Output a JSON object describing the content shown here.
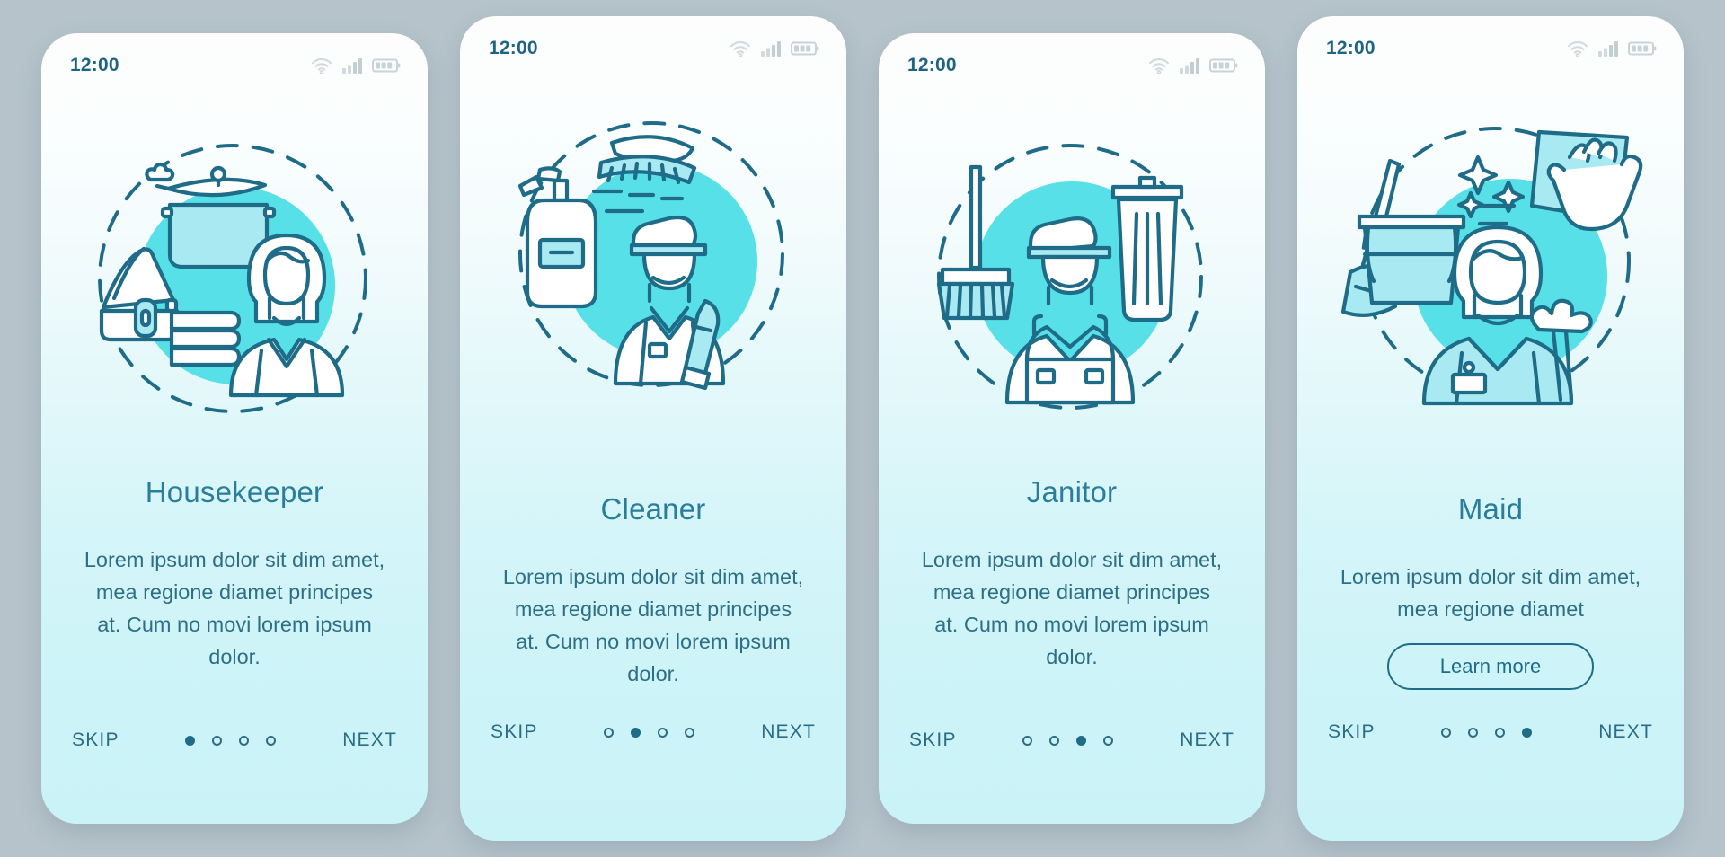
{
  "palette": {
    "page_background": "#b6c3cb",
    "screen_gradient_top": "#fdfdfd",
    "screen_gradient_bottom": "#caf3f8",
    "ink": "#1f6c88",
    "accent_circle": "#58e0e8",
    "fill_light": "#a9e9f2",
    "title_color": "#2a7e9a",
    "body_color": "#2f6f86"
  },
  "status_bar": {
    "time": "12:00",
    "icons": [
      "wifi-icon",
      "cellular-signal-icon",
      "battery-icon"
    ]
  },
  "nav": {
    "skip_label": "SKIP",
    "next_label": "NEXT",
    "total_dots": 4
  },
  "screens": [
    {
      "id": "housekeeper",
      "illustration": "housekeeper-illustration",
      "illustration_items": [
        "steaming-pot-icon",
        "iron-icon",
        "folded-towels-icon",
        "housekeeper-woman-icon"
      ],
      "title": "Housekeeper",
      "body": "Lorem ipsum dolor sit dim amet, mea regione diamet principes at. Cum no movi lorem ipsum dolor.",
      "active_dot": 1,
      "has_learn_more": false,
      "learn_more_label": ""
    },
    {
      "id": "cleaner",
      "illustration": "cleaner-illustration",
      "illustration_items": [
        "scrub-brush-icon",
        "spray-bottle-icon",
        "cleaner-man-icon",
        "squeegee-icon"
      ],
      "title": "Cleaner",
      "body": "Lorem ipsum dolor sit dim amet, mea regione diamet principes at. Cum no movi lorem ipsum dolor.",
      "active_dot": 2,
      "has_learn_more": false,
      "learn_more_label": ""
    },
    {
      "id": "janitor",
      "illustration": "janitor-illustration",
      "illustration_items": [
        "push-broom-icon",
        "trash-can-icon",
        "janitor-man-icon"
      ],
      "title": "Janitor",
      "body": "Lorem ipsum dolor sit dim amet, mea regione diamet principes at. Cum no movi lorem ipsum dolor.",
      "active_dot": 3,
      "has_learn_more": false,
      "learn_more_label": ""
    },
    {
      "id": "maid",
      "illustration": "maid-illustration",
      "illustration_items": [
        "mop-and-bucket-icon",
        "wiping-hand-cloth-icon",
        "sparkle-icon",
        "maid-woman-icon",
        "feather-duster-icon"
      ],
      "title": "Maid",
      "body": "Lorem ipsum dolor sit dim amet, mea regione diamet",
      "active_dot": 4,
      "has_learn_more": true,
      "learn_more_label": "Learn more"
    }
  ]
}
